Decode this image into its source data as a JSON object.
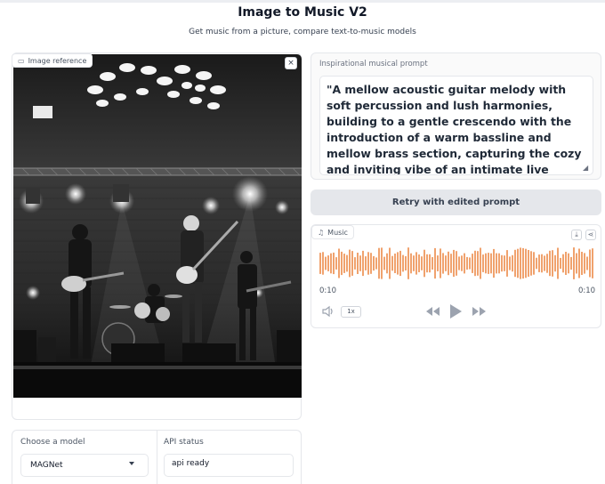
{
  "header": {
    "title": "Image to Music V2",
    "subtitle": "Get music from a picture, compare text-to-music models"
  },
  "image_panel": {
    "label": "Image reference",
    "icons": [
      "image-icon",
      "close-icon",
      "upload-icon",
      "webcam-icon",
      "clipboard-icon"
    ],
    "scene": "black-and-white photo of a band performing on stage: drummer, guitarists and a bassist under spotlights with circular ceiling lights",
    "close_label": "×"
  },
  "prompt_panel": {
    "label": "Inspirational musical prompt",
    "value": "\"A mellow acoustic guitar melody with soft percussion and lush harmonies, building to a gentle crescendo with the introduction of a warm bassline and mellow brass section, capturing the cozy and inviting vibe of an intimate live performance.\""
  },
  "retry_button": {
    "label": "Retry with edited prompt"
  },
  "audio_panel": {
    "label": "Music",
    "current_time": "0:10",
    "duration": "0:10",
    "speed": "1x",
    "waveform_color": "#ea7a2f",
    "icons": [
      "music-icon",
      "download-icon",
      "share-icon",
      "volume-icon",
      "rewind-icon",
      "play-icon",
      "fast-forward-icon"
    ]
  },
  "model_panel": {
    "label": "Choose a model",
    "selected": "MAGNet"
  },
  "api_panel": {
    "label": "API status",
    "value": "api ready"
  },
  "colors": {
    "accent": "#ea7a2f",
    "button_bg": "#e5e7eb",
    "border": "#e5e7eb"
  }
}
